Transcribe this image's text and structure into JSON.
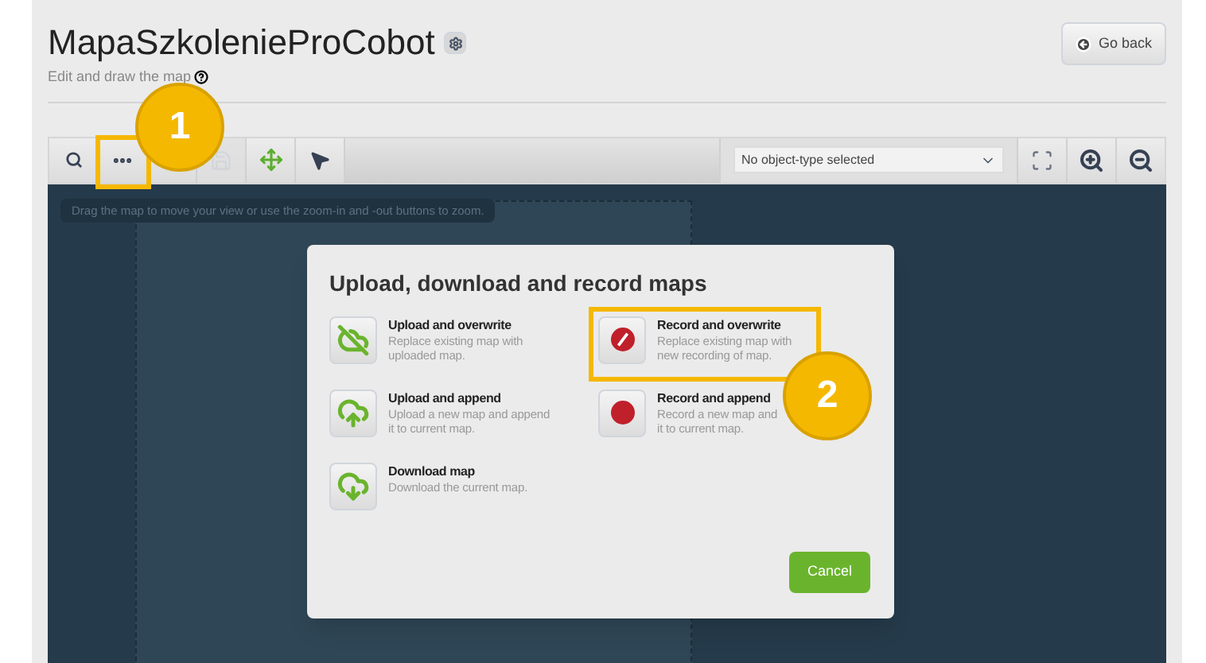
{
  "page": {
    "title": "MapaSzkolenieProCobot",
    "subtitle": "Edit and draw the map",
    "back_button": "Go back"
  },
  "toolbar": {
    "tools": [
      {
        "kind": "search",
        "disabled": false
      },
      {
        "kind": "more",
        "disabled": false,
        "callout": "1"
      },
      {
        "kind": "blank"
      },
      {
        "kind": "save",
        "disabled": true
      },
      {
        "kind": "move",
        "disabled": false
      },
      {
        "kind": "pointer",
        "disabled": false
      }
    ],
    "object_type_select": {
      "value": "No object-type selected"
    },
    "view_tools": [
      {
        "kind": "fit"
      },
      {
        "kind": "zoom-in"
      },
      {
        "kind": "zoom-out"
      }
    ]
  },
  "map": {
    "hint": "Drag the map to move your view or use the zoom-in and -out buttons to zoom."
  },
  "dialog": {
    "title": "Upload, download and record maps",
    "options": [
      {
        "kind": "upload-overwrite",
        "title": "Upload and overwrite",
        "lines": [
          "Replace existing map with",
          "uploaded map."
        ]
      },
      {
        "kind": "record-overwrite",
        "title": "Record and overwrite",
        "lines": [
          "Replace existing map with",
          "new recording of map."
        ],
        "callout": "2"
      },
      {
        "kind": "upload-append",
        "title": "Upload and append",
        "lines": [
          "Upload a new map and append",
          "it to current map."
        ]
      },
      {
        "kind": "record-append",
        "title": "Record and append",
        "lines": [
          "Record a new map and",
          "it to current map."
        ]
      },
      {
        "kind": "download",
        "title": "Download map",
        "lines": [
          "Download the current map."
        ]
      }
    ],
    "cancel_button": "Cancel"
  }
}
